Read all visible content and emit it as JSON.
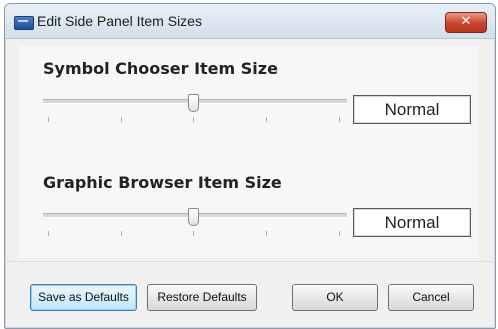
{
  "window": {
    "title": "Edit Side Panel Item Sizes",
    "close_glyph": "✕"
  },
  "sections": [
    {
      "label": "Symbol Chooser Item Size",
      "slider_value": "Normal",
      "slider_position": 0.5,
      "tick_count": 5
    },
    {
      "label": "Graphic Browser Item Size",
      "slider_value": "Normal",
      "slider_position": 0.5,
      "tick_count": 5
    }
  ],
  "buttons": {
    "save_defaults": "Save as Defaults",
    "restore_defaults": "Restore Defaults",
    "ok": "OK",
    "cancel": "Cancel"
  },
  "icons": {
    "app": "app-window-icon",
    "close": "close-icon"
  }
}
